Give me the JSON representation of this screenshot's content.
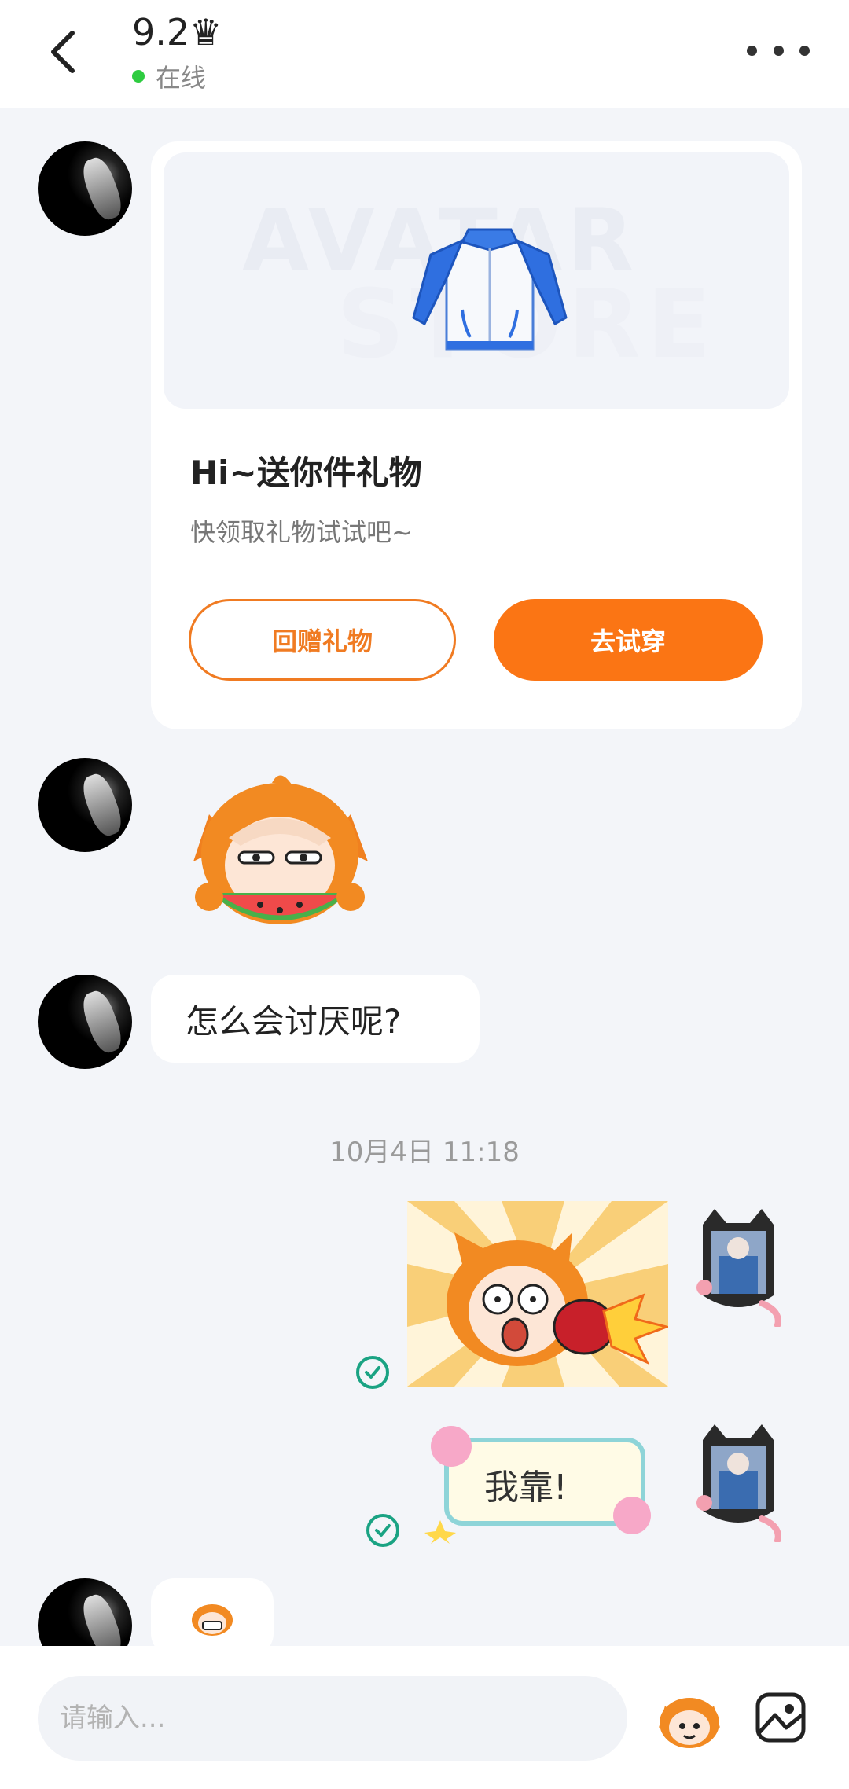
{
  "header": {
    "title": "9.2♛",
    "status": "在线",
    "status_color": "#2ecc40"
  },
  "gift_card": {
    "banner_line1": "AVATAR",
    "banner_line2": "STORE",
    "title": "Hi~送你件礼物",
    "subtitle": "快领取礼物试试吧~",
    "return_gift_label": "回赠礼物",
    "try_on_label": "去试穿"
  },
  "messages": {
    "text_bubble": "怎么会讨厌呢?",
    "timestamp": "10月4日 11:18",
    "sticker_text": "我靠!"
  },
  "input": {
    "placeholder": "请输入..."
  },
  "colors": {
    "accent": "#fb7514",
    "check": "#1aa383",
    "background": "#f3f5f9"
  },
  "icons": [
    "back-arrow-icon",
    "more-dots-icon",
    "jacket-gift-icon",
    "sticker-eating-watermelon",
    "sticker-shocked",
    "sticker-wobuzai",
    "read-check-icon",
    "emoji-icon",
    "image-icon"
  ]
}
